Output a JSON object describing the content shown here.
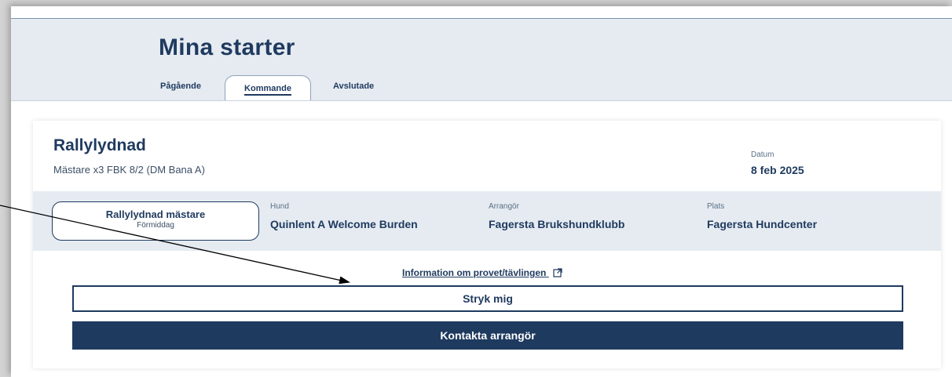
{
  "page": {
    "title": "Mina starter",
    "tabs": [
      {
        "label": "Pågående",
        "active": false
      },
      {
        "label": "Kommande",
        "active": true
      },
      {
        "label": "Avslutade",
        "active": false
      }
    ]
  },
  "event": {
    "title": "Rallylydnad",
    "subtitle": "Mästare x3 FBK 8/2 (DM Bana A)",
    "date_label": "Datum",
    "date_value": "8 feb 2025",
    "class_name": "Rallylydnad mästare",
    "class_session": "Förmiddag",
    "hund_label": "Hund",
    "hund_value": "Quinlent A Welcome Burden",
    "arrangor_label": "Arrangör",
    "arrangor_value": "Fagersta Brukshundklubb",
    "plats_label": "Plats",
    "plats_value": "Fagersta Hundcenter",
    "info_link": "Information om provet/tävlingen",
    "info_link_icon": "external-link-icon",
    "stryk_button": "Stryk mig",
    "kontakta_button": "Kontakta arrangör"
  },
  "colors": {
    "navy": "#1f3a5f",
    "header_bg": "#e5ebf1",
    "card_bg": "#ffffff"
  }
}
